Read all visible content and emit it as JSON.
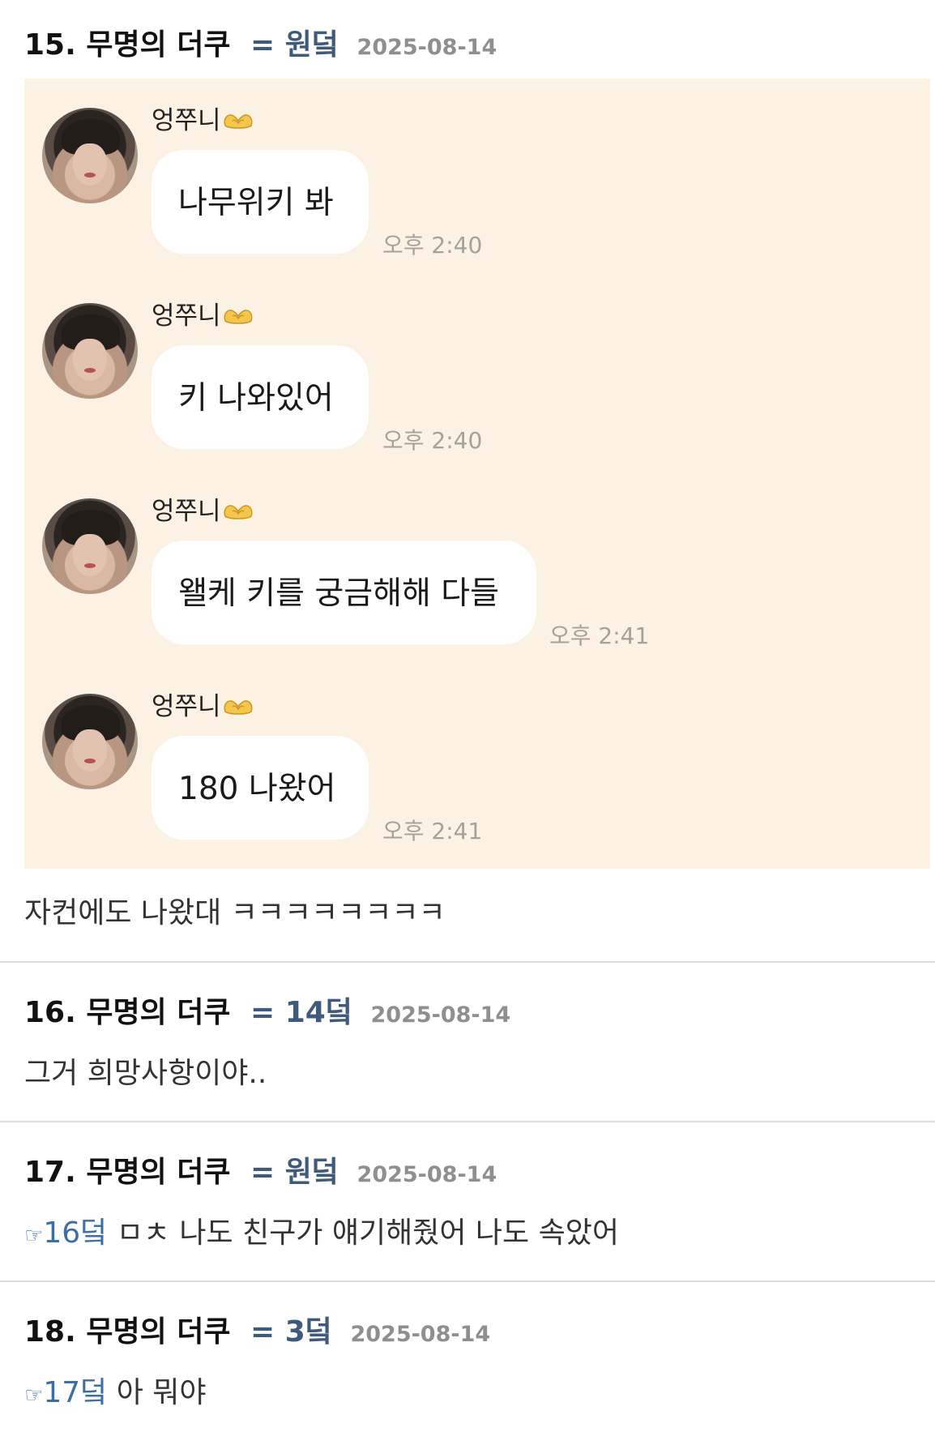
{
  "comments": [
    {
      "number": "15.",
      "author": "무명의 더쿠",
      "equals": "=",
      "tag": "원덬",
      "date": "2025-08-14",
      "chat": [
        {
          "sender": "엉쭈니",
          "text": "나무위키 봐",
          "time": "오후 2:40"
        },
        {
          "sender": "엉쭈니",
          "text": "키 나와있어",
          "time": "오후 2:40"
        },
        {
          "sender": "엉쭈니",
          "text": "왤케 키를 궁금해해 다들",
          "time": "오후 2:41"
        },
        {
          "sender": "엉쭈니",
          "text": "180 나왔어",
          "time": "오후 2:41"
        }
      ],
      "body": "자컨에도 나왔대 ㅋㅋㅋㅋㅋㅋㅋㅋ"
    },
    {
      "number": "16.",
      "author": "무명의 더쿠",
      "equals": "=",
      "tag": "14덬",
      "date": "2025-08-14",
      "body": "그거 희망사항이야.."
    },
    {
      "number": "17.",
      "author": "무명의 더쿠",
      "equals": "=",
      "tag": "원덬",
      "date": "2025-08-14",
      "reply_hand": "☞",
      "reply_ref": "16덬",
      "body": "ㅁㅊ 나도 친구가 얘기해줬어 나도 속았어"
    },
    {
      "number": "18.",
      "author": "무명의 더쿠",
      "equals": "=",
      "tag": "3덬",
      "date": "2025-08-14",
      "reply_hand": "☞",
      "reply_ref": "17덬",
      "body": "아 뭐야"
    }
  ],
  "colors": {
    "tag": "#3f5a7a",
    "reply_link": "#3c6fa6",
    "date": "#8f8f8f",
    "chat_background": "#fbf2e3",
    "bubble": "#ffffff"
  },
  "icons": {
    "heart_hands": "heart-hands-emoji",
    "reply": "pointing-hand-icon"
  }
}
